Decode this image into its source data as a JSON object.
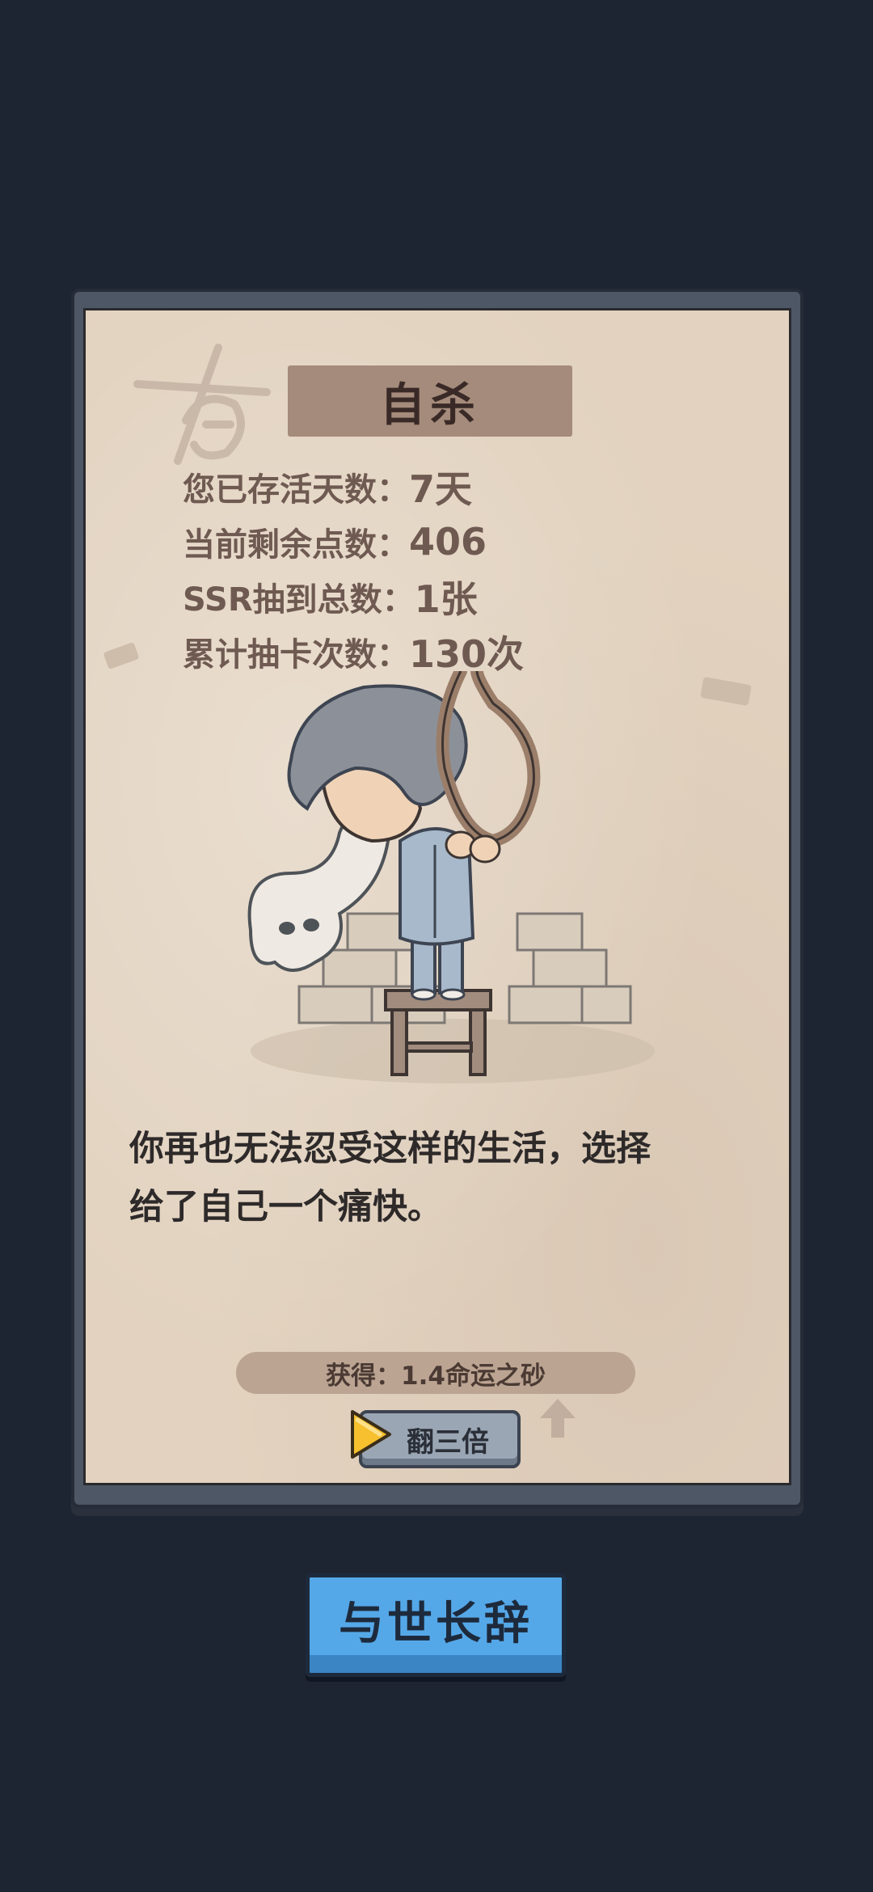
{
  "card": {
    "title": "自杀",
    "stats": [
      {
        "label": "您已存活天数：",
        "value": "7天"
      },
      {
        "label": "当前剩余点数：",
        "value": "406"
      },
      {
        "label": "SSR抽到总数：",
        "value": "1张"
      },
      {
        "label": "累计抽卡次数：",
        "value": "130次"
      }
    ],
    "story_line1": "你再也无法忍受这样的生活，选择",
    "story_line2": "给了自己一个痛快。",
    "reward": "获得：1.4命运之砂",
    "triple_button": "翻三倍"
  },
  "main_button": "与世长辞",
  "colors": {
    "background": "#1e2532",
    "paper": "#e2d2bf",
    "title_box": "#a58b7b",
    "button_blue": "#55a8e8"
  },
  "icons": [
    "play-icon",
    "up-arrow-icon",
    "watermark-stamp-icon"
  ]
}
